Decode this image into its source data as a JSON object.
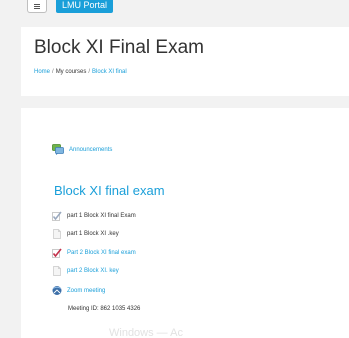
{
  "topbar": {
    "menu_icon": "hamburger-icon",
    "portal_label": "LMU Portal"
  },
  "header": {
    "title": "Block XI Final Exam",
    "breadcrumb": [
      {
        "label": "Home",
        "link": true
      },
      {
        "label": "My courses",
        "link": false
      },
      {
        "label": "Block XI final",
        "link": true
      }
    ]
  },
  "content": {
    "announcements": {
      "label": "Announcements",
      "icon": "forum-icon"
    },
    "section_title": "Block XI final exam",
    "activities": [
      {
        "label": "part 1 Block XI final Exam",
        "icon": "quiz-icon",
        "link": false
      },
      {
        "label": "part 1 Block XI .key",
        "icon": "file-icon",
        "link": false
      },
      {
        "label": "Part 2 Block XI final exam",
        "icon": "quiz-icon",
        "link": true
      },
      {
        "label": "part 2 Block XI. key",
        "icon": "file-icon",
        "link": true
      },
      {
        "label": "Zoom meeting",
        "icon": "zoom-icon",
        "link": true
      }
    ],
    "meeting_id": "Meeting ID: 862 1035 4326"
  },
  "watermark": "Windows — Ac",
  "colors": {
    "accent": "#1a9fd9",
    "text": "#333333",
    "background": "#f2f2f2"
  }
}
